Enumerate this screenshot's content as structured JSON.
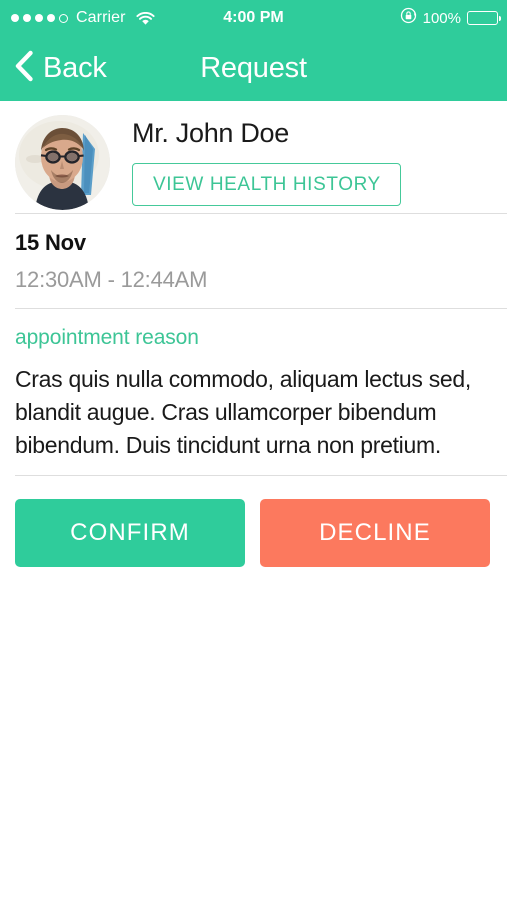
{
  "status_bar": {
    "signal_dots_filled": 4,
    "signal_dots_total": 5,
    "carrier": "Carrier",
    "wifi_icon": "wifi-icon",
    "time": "4:00 PM",
    "rotation_lock_icon": "rotation-lock-icon",
    "battery_percent": "100%",
    "battery_icon": "battery-full-icon"
  },
  "nav": {
    "back_icon": "chevron-left-icon",
    "back_label": "Back",
    "title": "Request"
  },
  "profile": {
    "avatar_name": "avatar",
    "patient_name": "Mr. John Doe",
    "health_history_label": "VIEW HEALTH HISTORY"
  },
  "appointment": {
    "date": "15 Nov",
    "time_range": "12:30AM - 12:44AM",
    "reason_heading": "appointment reason",
    "reason_text": "Cras quis nulla commodo, aliquam lectus sed, blandit augue. Cras ullamcorper bibendum bibendum. Duis tincidunt urna non pretium."
  },
  "actions": {
    "confirm_label": "CONFIRM",
    "decline_label": "DECLINE"
  },
  "colors": {
    "brand_green": "#2fcc9b",
    "accent_green_text": "#3dc596",
    "decline_coral": "#fc795e",
    "divider": "#dedede",
    "muted_text": "#9a9a9a"
  }
}
